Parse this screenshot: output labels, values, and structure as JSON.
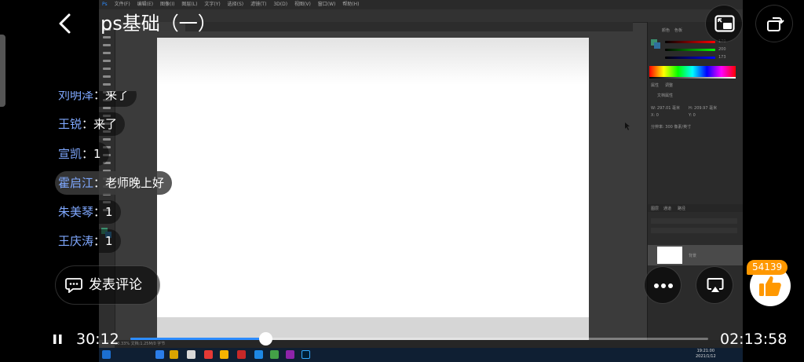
{
  "header": {
    "title": "ps基础（一）"
  },
  "video": {
    "ps_menu": [
      "文件(F)",
      "编辑(E)",
      "图像(I)",
      "图层(L)",
      "文字(Y)",
      "选择(S)",
      "滤镜(T)",
      "3D(D)",
      "视图(V)",
      "窗口(W)",
      "帮助(H)"
    ],
    "panel_tabs": {
      "color": [
        "颜色",
        "色板"
      ],
      "properties": [
        "属性",
        "调整"
      ],
      "layers": [
        "图层",
        "通道",
        "路径"
      ]
    },
    "color_values": [
      "170",
      "200",
      "173"
    ],
    "properties": {
      "title": "文档属性",
      "w": "W: 297.01 毫米",
      "h": "H: 209.97 毫米",
      "x": "X: 0",
      "y": "Y: 0",
      "resolution": "分辨率: 300 像素/英寸"
    },
    "layer_name": "背景",
    "statusbar": "33.33%  文档:1.25M/0 字节",
    "clock": {
      "time": "19:21:00",
      "date": "2021/1/12"
    }
  },
  "comments": [
    {
      "name": "刘明泽",
      "sep": "：",
      "text": "来了"
    },
    {
      "name": "王锐",
      "sep": "：",
      "text": "来了"
    },
    {
      "name": "宣凯",
      "sep": "：",
      "text": "1"
    },
    {
      "name": "霍启江",
      "sep": "：",
      "text": "老师晚上好"
    },
    {
      "name": "朱美琴",
      "sep": "：",
      "text": "1"
    },
    {
      "name": "王庆涛",
      "sep": "：",
      "text": "1"
    }
  ],
  "comment_button": {
    "label": "发表评论",
    "icon": "comment-icon"
  },
  "like": {
    "count": "54139",
    "icon": "thumbs-up-icon"
  },
  "player": {
    "current_time": "30:12",
    "total_time": "02:13:58",
    "progress_fraction": 0.234
  },
  "colors": {
    "accent": "#2d8cff",
    "username": "#7fa8ff",
    "like_badge": "#ff9800"
  },
  "icons": [
    "back-icon",
    "pip-icon",
    "rotate-icon",
    "more-icon",
    "airplay-icon",
    "pause-icon"
  ]
}
